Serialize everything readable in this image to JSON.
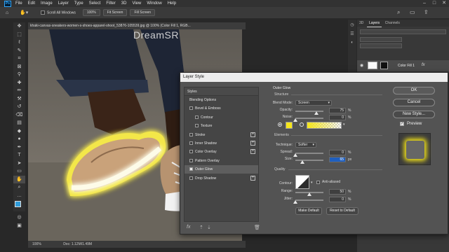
{
  "app": {
    "logo": "Ps"
  },
  "menubar": {
    "items": [
      "File",
      "Edit",
      "Image",
      "Layer",
      "Type",
      "Select",
      "Filter",
      "3D",
      "View",
      "Window",
      "Help"
    ]
  },
  "options_bar": {
    "scroll_all_windows": "Scroll All Windows",
    "zoom": "100%",
    "fit_screen": "Fit Screen",
    "fill_screen": "Fill Screen"
  },
  "document": {
    "tab_title": "khaki-canvas-sneakers-women-s-shoes-apparel-shoot_53876-105539.jpg @ 100% (Color Fill 1, RGB...",
    "watermark": "DreamSR",
    "status_zoom": "100%",
    "status_doc": "Doc: 1.12M/1.49M"
  },
  "panels": {
    "tabs": [
      "3D",
      "Layers",
      "Channels"
    ],
    "active_tab": "Layers",
    "layer_name": "Color Fill 1"
  },
  "dialog": {
    "title": "Layer Style",
    "styles_header": "Styles",
    "styles": [
      {
        "label": "Blending Options",
        "checkbox": false,
        "checked": false,
        "plus": false,
        "indent": false
      },
      {
        "label": "Bevel & Emboss",
        "checkbox": true,
        "checked": false,
        "plus": false,
        "indent": false
      },
      {
        "label": "Contour",
        "checkbox": true,
        "checked": false,
        "plus": false,
        "indent": true
      },
      {
        "label": "Texture",
        "checkbox": true,
        "checked": false,
        "plus": false,
        "indent": true
      },
      {
        "label": "Stroke",
        "checkbox": true,
        "checked": false,
        "plus": true,
        "indent": false
      },
      {
        "label": "Inner Shadow",
        "checkbox": true,
        "checked": false,
        "plus": true,
        "indent": false
      },
      {
        "label": "Color Overlay",
        "checkbox": true,
        "checked": false,
        "plus": true,
        "indent": false
      },
      {
        "label": "Pattern Overlay",
        "checkbox": true,
        "checked": false,
        "plus": false,
        "indent": false
      },
      {
        "label": "Outer Glow",
        "checkbox": true,
        "checked": true,
        "plus": false,
        "indent": false
      },
      {
        "label": "Drop Shadow",
        "checkbox": true,
        "checked": false,
        "plus": true,
        "indent": false
      }
    ],
    "footer_fx": "fx",
    "outer_glow": {
      "title": "Outer Glow",
      "structure": "Structure",
      "blend_mode_label": "Blend Mode:",
      "blend_mode": "Screen",
      "opacity_label": "Opacity:",
      "opacity": "75",
      "opacity_fraction": 0.75,
      "noise_label": "Noise:",
      "noise": "0",
      "noise_fraction": 0,
      "glow_color": "#f6e61a",
      "elements": "Elements",
      "technique_label": "Technique:",
      "technique": "Softer",
      "spread_label": "Spread:",
      "spread": "0",
      "spread_fraction": 0,
      "size_label": "Size:",
      "size": "65",
      "size_fraction": 0.26,
      "quality": "Quality",
      "contour_label": "Contour:",
      "anti_aliased": "Anti-aliased",
      "range_label": "Range:",
      "range": "50",
      "range_fraction": 0.5,
      "jitter_label": "Jitter:",
      "jitter": "0",
      "jitter_fraction": 0,
      "pct": "%",
      "px": "px",
      "make_default": "Make Default",
      "reset_default": "Reset to Default"
    },
    "ok": "OK",
    "cancel": "Cancel",
    "new_style": "New Style...",
    "preview": "Preview"
  }
}
